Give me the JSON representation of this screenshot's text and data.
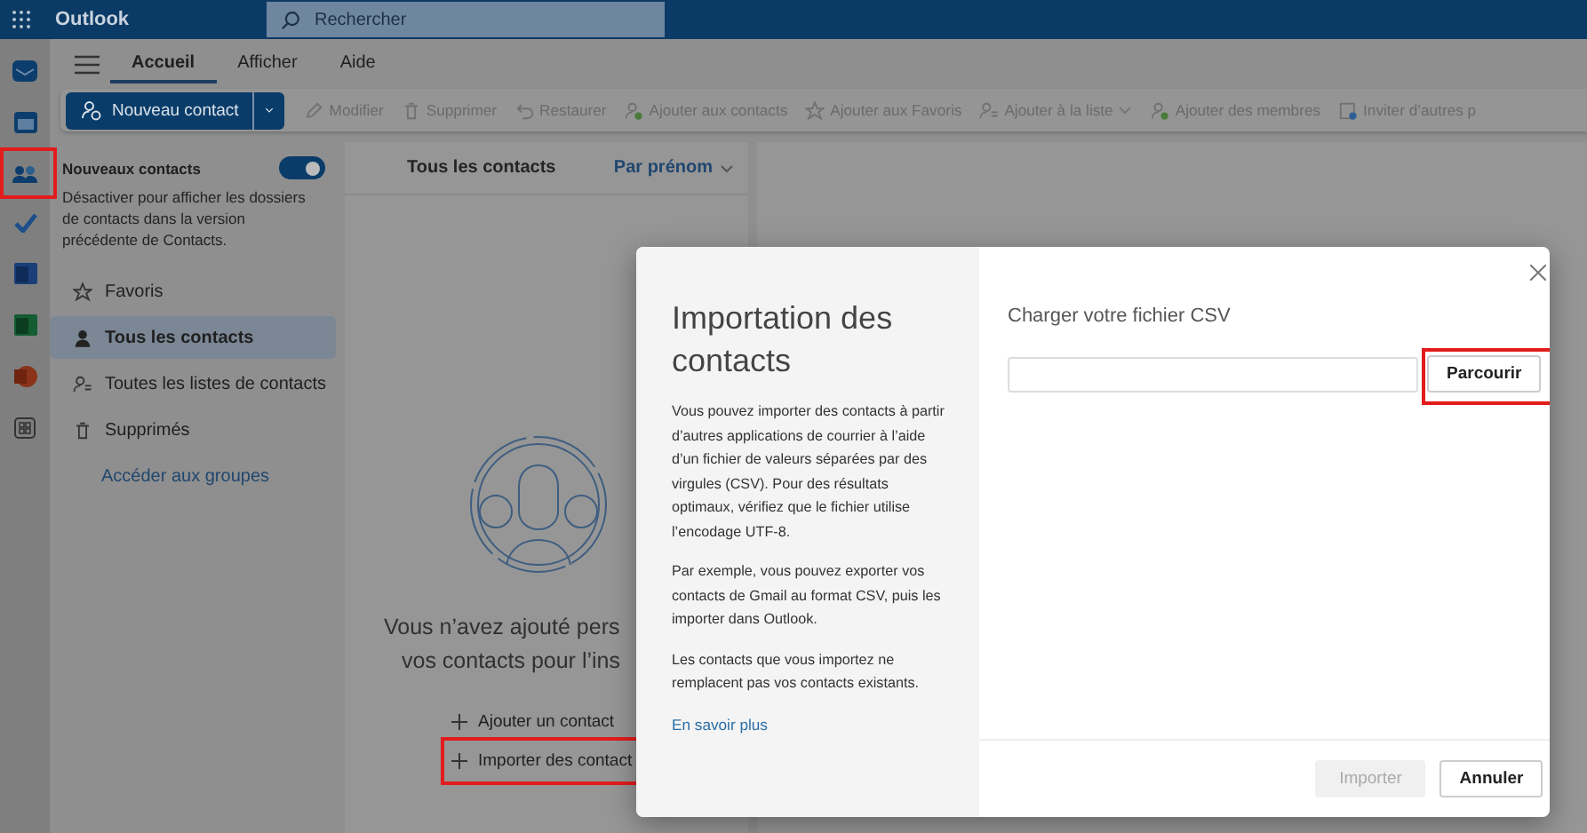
{
  "app": {
    "title": "Outlook",
    "search_placeholder": "Rechercher"
  },
  "tabs": [
    {
      "label": "Accueil",
      "selected": true
    },
    {
      "label": "Afficher",
      "selected": false
    },
    {
      "label": "Aide",
      "selected": false
    }
  ],
  "toolbar": {
    "primary": "Nouveau contact",
    "actions": [
      {
        "label": "Modifier",
        "kind": "edit",
        "disabled": true,
        "has_menu": false
      },
      {
        "label": "Supprimer",
        "kind": "delete",
        "disabled": true,
        "has_menu": false
      },
      {
        "label": "Restaurer",
        "kind": "restore",
        "disabled": true,
        "has_menu": false
      },
      {
        "label": "Ajouter aux contacts",
        "kind": "add-person",
        "disabled": true,
        "has_menu": false
      },
      {
        "label": "Ajouter aux Favoris",
        "kind": "star",
        "disabled": true,
        "has_menu": false
      },
      {
        "label": "Ajouter à la liste",
        "kind": "list",
        "disabled": true,
        "has_menu": true
      },
      {
        "label": "Ajouter des membres",
        "kind": "add-person",
        "disabled": true,
        "has_menu": false
      },
      {
        "label": "Inviter d’autres p",
        "kind": "invite",
        "disabled": true,
        "has_menu": false
      }
    ]
  },
  "nav": {
    "toggle": {
      "label": "Nouveaux contacts",
      "on": true,
      "description": "Désactiver pour afficher les dossiers de contacts dans la version précédente de Contacts."
    },
    "items": [
      {
        "label": "Favoris",
        "kind": "star",
        "selected": false
      },
      {
        "label": "Tous les contacts",
        "kind": "person",
        "selected": true
      },
      {
        "label": "Toutes les listes de contacts",
        "kind": "list",
        "selected": false
      },
      {
        "label": "Supprimés",
        "kind": "delete",
        "selected": false
      }
    ],
    "link": "Accéder aux groupes"
  },
  "list": {
    "title": "Tous les contacts",
    "sort": "Par prénom",
    "empty_lines": [
      "Vous n’avez ajouté pers",
      "vos contacts pour l’ins"
    ],
    "actions": [
      "Ajouter un contact",
      "Importer des contact"
    ]
  },
  "dialog": {
    "title": "Importation des contacts",
    "paragraphs": [
      "Vous pouvez importer des contacts à partir d’autres applications de courrier à l’aide d’un fichier de valeurs séparées par des virgules (CSV). Pour des résultats optimaux, vérifiez que le fichier utilise l’encodage UTF-8.",
      "Par exemple, vous pouvez exporter vos contacts de Gmail au format CSV, puis les importer dans Outlook.",
      "Les contacts que vous importez ne remplacent pas vos contacts existants."
    ],
    "link": "En savoir plus",
    "heading": "Charger votre fichier CSV",
    "browse": "Parcourir",
    "buttons": [
      {
        "label": "Importer",
        "disabled": true
      },
      {
        "label": "Annuler",
        "disabled": false
      }
    ]
  }
}
